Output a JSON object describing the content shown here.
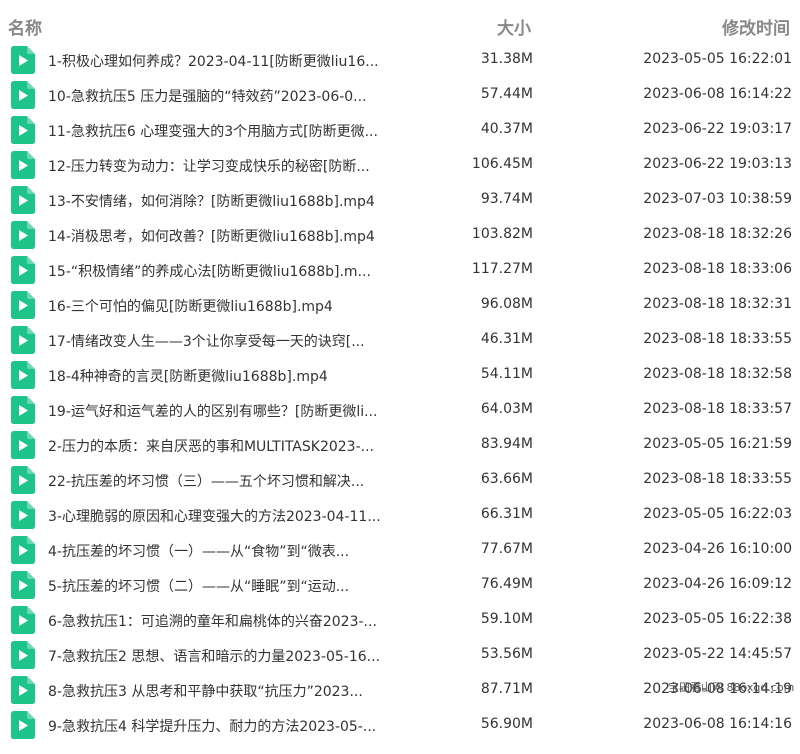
{
  "header": {
    "name": "名称",
    "size": "大小",
    "time": "修改时间"
  },
  "colors": {
    "icon_green": "#1ec48a",
    "header_gray": "#888888"
  },
  "files": [
    {
      "name": "1-积极心理如何养成？2023-04-11[防断更微liu16...",
      "size": "31.38M",
      "time": "2023-05-05 16:22:01"
    },
    {
      "name": "10-急救抗压5 压力是强脑的“特效药”2023-06-0...",
      "size": "57.44M",
      "time": "2023-06-08 16:14:22"
    },
    {
      "name": "11-急救抗压6 心理变强大的3个用脑方式[防断更微...",
      "size": "40.37M",
      "time": "2023-06-22 19:03:17"
    },
    {
      "name": "12-压力转变为动力：让学习变成快乐的秘密[防断...",
      "size": "106.45M",
      "time": "2023-06-22 19:03:13"
    },
    {
      "name": "13-不安情绪，如何消除？[防断更微liu1688b].mp4",
      "size": "93.74M",
      "time": "2023-07-03 10:38:59"
    },
    {
      "name": "14-消极思考，如何改善？[防断更微liu1688b].mp4",
      "size": "103.82M",
      "time": "2023-08-18 18:32:26"
    },
    {
      "name": "15-“积极情绪”的养成心法[防断更微liu1688b].m...",
      "size": "117.27M",
      "time": "2023-08-18 18:33:06"
    },
    {
      "name": "16-三个可怕的偏见[防断更微liu1688b].mp4",
      "size": "96.08M",
      "time": "2023-08-18 18:32:31"
    },
    {
      "name": "17-情绪改变人生——3个让你享受每一天的诀窍[...",
      "size": "46.31M",
      "time": "2023-08-18 18:33:55"
    },
    {
      "name": "18-4种神奇的言灵[防断更微liu1688b].mp4",
      "size": "54.11M",
      "time": "2023-08-18 18:32:58"
    },
    {
      "name": "19-运气好和运气差的人的区别有哪些？[防断更微li...",
      "size": "64.03M",
      "time": "2023-08-18 18:33:57"
    },
    {
      "name": "2-压力的本质：来自厌恶的事和MULTITASK2023-...",
      "size": "83.94M",
      "time": "2023-05-05 16:21:59"
    },
    {
      "name": "22-抗压差的坏习惯（三）——五个坏习惯和解决...",
      "size": "63.66M",
      "time": "2023-08-18 18:33:55"
    },
    {
      "name": "3-心理脆弱的原因和心理变强大的方法2023-04-11...",
      "size": "66.31M",
      "time": "2023-05-05 16:22:03"
    },
    {
      "name": "4-抗压差的坏习惯（一）——从“食物”到“微表...",
      "size": "77.67M",
      "time": "2023-04-26 16:10:00"
    },
    {
      "name": "5-抗压差的坏习惯（二）——从“睡眠”到“运动...",
      "size": "76.49M",
      "time": "2023-04-26 16:09:12"
    },
    {
      "name": "6-急救抗压1：可追溯的童年和扁桃体的兴奋2023-...",
      "size": "59.10M",
      "time": "2023-05-05 16:22:38"
    },
    {
      "name": "7-急救抗压2 思想、语言和暗示的力量2023-05-16...",
      "size": "53.56M",
      "time": "2023-05-22 14:45:57"
    },
    {
      "name": "8-急救抗压3 从思考和平静中获取“抗压力”2023...",
      "size": "87.71M",
      "time": "2023-06-08 16:14:19"
    },
    {
      "name": "9-急救抗压4 科学提升压力、耐力的方法2023-05-...",
      "size": "56.90M",
      "time": "2023-06-08 16:14:16"
    }
  ],
  "watermark": "宝田看山网 88oxqq.com"
}
